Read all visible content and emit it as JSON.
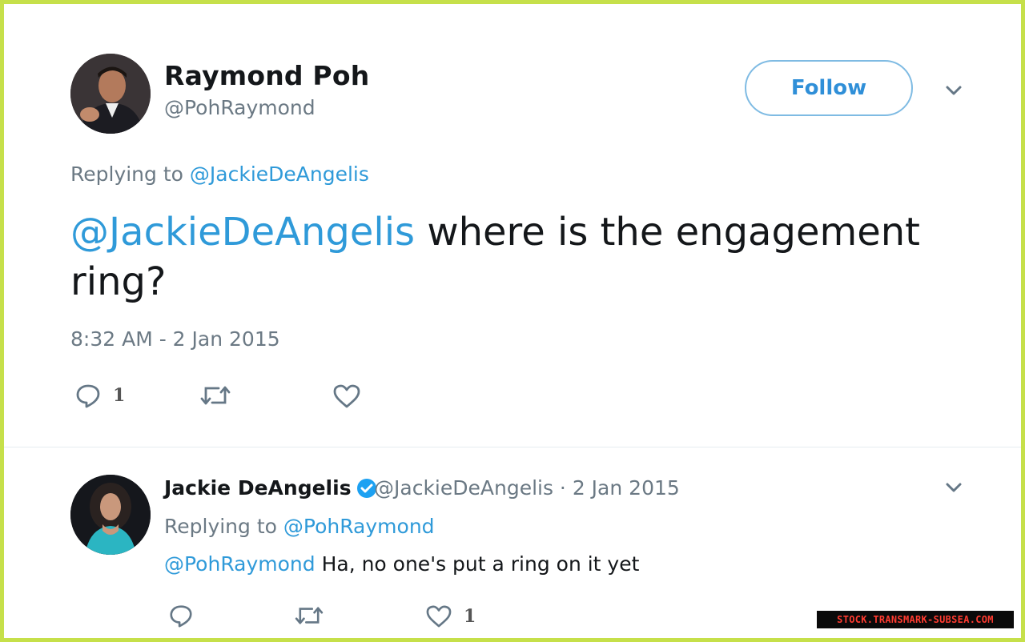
{
  "tweet": {
    "author_name": "Raymond Poh",
    "author_handle": "@PohRaymond",
    "follow_label": "Follow",
    "replying_prefix": "Replying to",
    "replying_handle": "@JackieDeAngelis",
    "text_mention": "@JackieDeAngelis",
    "text_body": " where is the engagement ring?",
    "timestamp": "8:32 AM - 2 Jan 2015",
    "reply_count": "1",
    "icons": [
      "reply-icon",
      "retweet-icon",
      "like-icon",
      "chevron-down-icon"
    ]
  },
  "reply": {
    "author_name": "Jackie DeAngelis",
    "verified_icon": "verified-badge-icon",
    "meta": "@JackieDeAngelis · 2 Jan 2015",
    "replying_prefix": "Replying to",
    "replying_handle": "@PohRaymond",
    "text_mention": "@PohRaymond",
    "text_body": " Ha, no one's put a ring on it yet",
    "like_count": "1"
  },
  "watermark": "STOCK.TRANSMARK-SUBSEA.COM",
  "colors": {
    "link": "#2f9ad9",
    "muted": "#6b7984",
    "border_frame": "#c6e04a",
    "verified": "#1da1f2"
  }
}
